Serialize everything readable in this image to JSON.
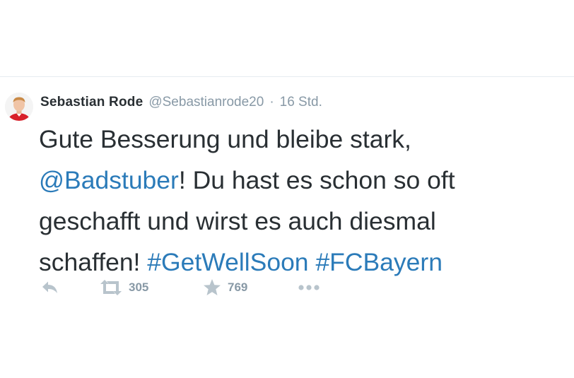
{
  "author": {
    "display_name": "Sebastian Rode",
    "screen_name": "@Sebastianrode20",
    "separator": "·",
    "time": "16 Std."
  },
  "tweet": {
    "line1": "Gute Besserung und bleibe stark,",
    "mention": "@Badstuber",
    "line2_rest": "! Du hast es schon so oft",
    "line3": "geschafft und wirst es auch diesmal",
    "line4_pre": "schaffen! ",
    "hashtag1": "#GetWellSoon",
    "hashtag2": "#FCBayern"
  },
  "actions": {
    "reply_icon": "reply-icon",
    "retweet_icon": "retweet-icon",
    "retweet_count": "305",
    "favorite_icon": "star-icon",
    "favorite_count": "769",
    "more_icon": "more-dots-icon"
  },
  "colors": {
    "text": "#292f33",
    "muted": "#8899a6",
    "link": "#2b7bb9",
    "icon": "#b8c4cc"
  }
}
